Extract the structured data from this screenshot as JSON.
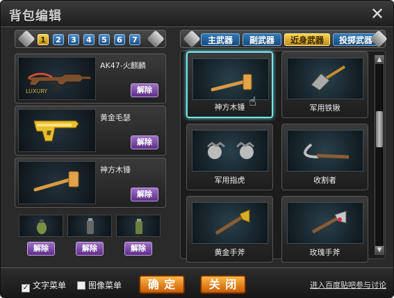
{
  "window": {
    "title": "背包编辑"
  },
  "left_tabs": [
    "1",
    "2",
    "3",
    "4",
    "5",
    "6",
    "7"
  ],
  "categories": [
    "主武器",
    "副武器",
    "近身武器",
    "投掷武器"
  ],
  "loadout": [
    {
      "name": "AK47-火麒麟",
      "icon": "rifle-icon",
      "badge": "LUXURY",
      "unload": "解除"
    },
    {
      "name": "黄金毛瑟",
      "icon": "pistol-icon",
      "unload": "解除"
    },
    {
      "name": "神方木锤",
      "icon": "hammer-icon",
      "unload": "解除"
    }
  ],
  "throwables": [
    {
      "icon": "grenade-icon",
      "unload": "解除"
    },
    {
      "icon": "flashbang-icon",
      "unload": "解除"
    },
    {
      "icon": "smoke-grenade-icon",
      "unload": "解除"
    }
  ],
  "inventory": [
    {
      "name": "神方木锤",
      "icon": "hammer-icon"
    },
    {
      "name": "军用铁锹",
      "icon": "shovel-icon"
    },
    {
      "name": "军用指虎",
      "icon": "knuckles-icon"
    },
    {
      "name": "收割者",
      "icon": "sickle-icon"
    },
    {
      "name": "黄金手斧",
      "icon": "axe-icon"
    },
    {
      "name": "玫瑰手斧",
      "icon": "axe-icon"
    }
  ],
  "footer": {
    "text_menu": "文字菜单",
    "image_menu": "图像菜单",
    "confirm": "确 定",
    "close": "关 闭",
    "forum_link": "进入百度贴吧参与讨论"
  },
  "colors": {
    "selected_border": "#73e6ea",
    "active_tab": "#f4d54e",
    "tab_blue": "#2f79b7",
    "purple_button": "#7b48a9",
    "orange_button": "#f39a2b"
  }
}
